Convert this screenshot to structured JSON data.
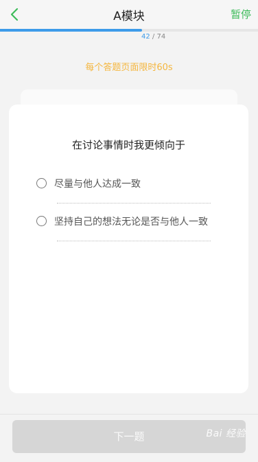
{
  "header": {
    "title": "A模块",
    "pause_label": "暂停"
  },
  "progress": {
    "current": "42",
    "separator": "/",
    "total": "74",
    "fraction": 0.55
  },
  "time_limit_text": "每个答题页面限时60s",
  "question": {
    "text": "在讨论事情时我更倾向于",
    "options": [
      {
        "label": "尽量与他人达成一致"
      },
      {
        "label": "坚持自己的想法无论是否与他人一致"
      }
    ]
  },
  "footer": {
    "next_label": "下一题"
  },
  "watermark": "Bai 经验",
  "colors": {
    "accent_green": "#3dbb5a",
    "progress_blue": "#3d9be9",
    "limit_orange": "#f4b63e"
  },
  "icons": {
    "back": "chevron-left-icon"
  }
}
